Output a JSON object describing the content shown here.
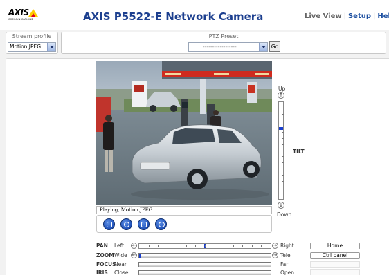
{
  "header": {
    "logo_text": "AXIS",
    "logo_subtext": "COMMUNICATIONS",
    "product_title": "AXIS P5522-E Network Camera",
    "nav": {
      "live_view": "Live View",
      "separator": "|",
      "setup": "Setup",
      "help": "Help"
    }
  },
  "stream_profile": {
    "label": "Stream profile",
    "value": "Motion JPEG"
  },
  "ptz_preset": {
    "label": "PTZ Preset",
    "value": "------------------",
    "go_label": "Go"
  },
  "video": {
    "status_text": "Playing, Motion JPEG",
    "toolbar_icons": [
      "stop-icon",
      "snapshot-icon",
      "view-full-icon",
      "emulate-joystick-icon"
    ]
  },
  "tilt": {
    "up_label": "Up",
    "down_label": "Down",
    "label": "TILT",
    "level": 0.27
  },
  "controls": {
    "pan": {
      "name": "PAN",
      "low": "Left",
      "high": "Right",
      "level": 0.5
    },
    "zoom": {
      "name": "ZOOM",
      "low": "Wide",
      "high": "Tele",
      "level": 0.0
    },
    "focus": {
      "name": "FOCUS",
      "low": "Near",
      "high": "Far"
    },
    "iris": {
      "name": "IRIS",
      "low": "Close",
      "high": "Open"
    }
  },
  "side_buttons": {
    "home": "Home",
    "ctrl_panel": "Ctrl panel"
  },
  "colors": {
    "brand_blue": "#1c3f8f",
    "accent_blue": "#1a3fd0",
    "logo_yellow": "#ffcc00"
  }
}
